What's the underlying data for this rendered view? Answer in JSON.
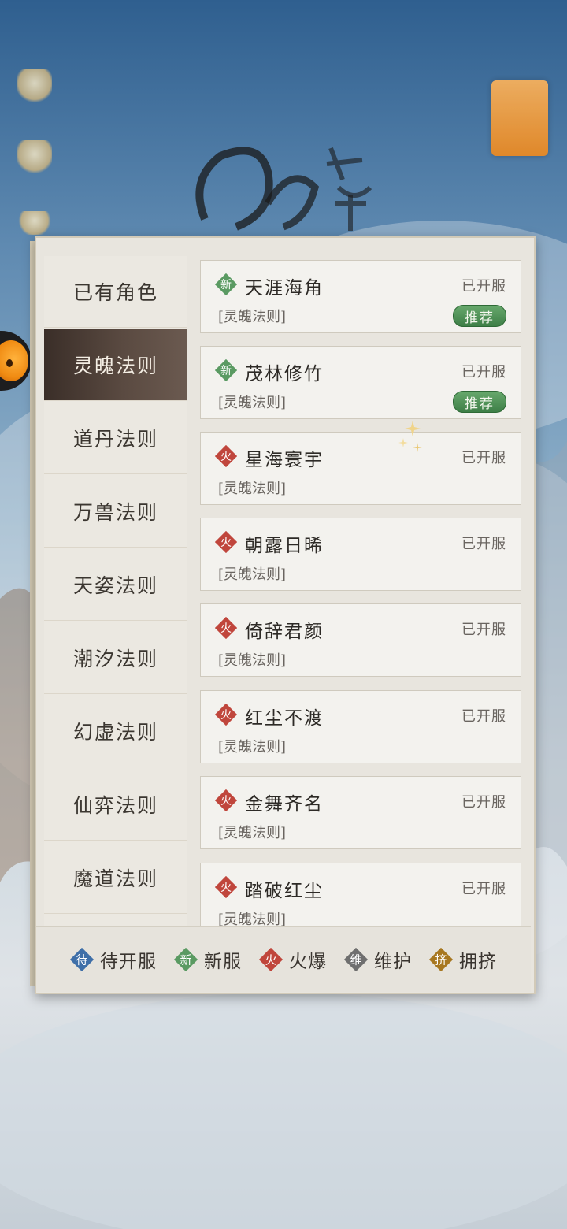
{
  "colors": {
    "accent_active_tab": "#3a2e28",
    "new_badge": "#5a9a62",
    "hot_badge": "#c0463c",
    "pending_badge": "#3f6fa8",
    "maintenance_badge": "#6f6f6f",
    "crowded_badge": "#a77720",
    "recommend": "#3e7f47"
  },
  "sidebar": {
    "tabs": [
      {
        "label": "已有角色",
        "active": false
      },
      {
        "label": "灵魄法则",
        "active": true
      },
      {
        "label": "道丹法则",
        "active": false
      },
      {
        "label": "万兽法则",
        "active": false
      },
      {
        "label": "天姿法则",
        "active": false
      },
      {
        "label": "潮汐法则",
        "active": false
      },
      {
        "label": "幻虚法则",
        "active": false
      },
      {
        "label": "仙弈法则",
        "active": false
      },
      {
        "label": "魔道法则",
        "active": false
      }
    ]
  },
  "servers": [
    {
      "badge": "新",
      "badge_type": "new",
      "name": "天涯海角",
      "group": "[灵魄法则]",
      "status": "已开服",
      "recommend": "推荐"
    },
    {
      "badge": "新",
      "badge_type": "new",
      "name": "茂林修竹",
      "group": "[灵魄法则]",
      "status": "已开服",
      "recommend": "推荐"
    },
    {
      "badge": "火",
      "badge_type": "hot",
      "name": "星海寰宇",
      "group": "[灵魄法则]",
      "status": "已开服",
      "recommend": ""
    },
    {
      "badge": "火",
      "badge_type": "hot",
      "name": "朝露日晞",
      "group": "[灵魄法则]",
      "status": "已开服",
      "recommend": ""
    },
    {
      "badge": "火",
      "badge_type": "hot",
      "name": "倚辞君颜",
      "group": "[灵魄法则]",
      "status": "已开服",
      "recommend": ""
    },
    {
      "badge": "火",
      "badge_type": "hot",
      "name": "红尘不渡",
      "group": "[灵魄法则]",
      "status": "已开服",
      "recommend": ""
    },
    {
      "badge": "火",
      "badge_type": "hot",
      "name": "金舞齐名",
      "group": "[灵魄法则]",
      "status": "已开服",
      "recommend": ""
    },
    {
      "badge": "火",
      "badge_type": "hot",
      "name": "踏破红尘",
      "group": "[灵魄法则]",
      "status": "已开服",
      "recommend": ""
    }
  ],
  "legend": [
    {
      "badge": "待",
      "label": "待开服",
      "type": "pending"
    },
    {
      "badge": "新",
      "label": "新服",
      "type": "new"
    },
    {
      "badge": "火",
      "label": "火爆",
      "type": "hot"
    },
    {
      "badge": "维",
      "label": "维护",
      "type": "maintenance"
    },
    {
      "badge": "挤",
      "label": "拥挤",
      "type": "crowded"
    }
  ]
}
